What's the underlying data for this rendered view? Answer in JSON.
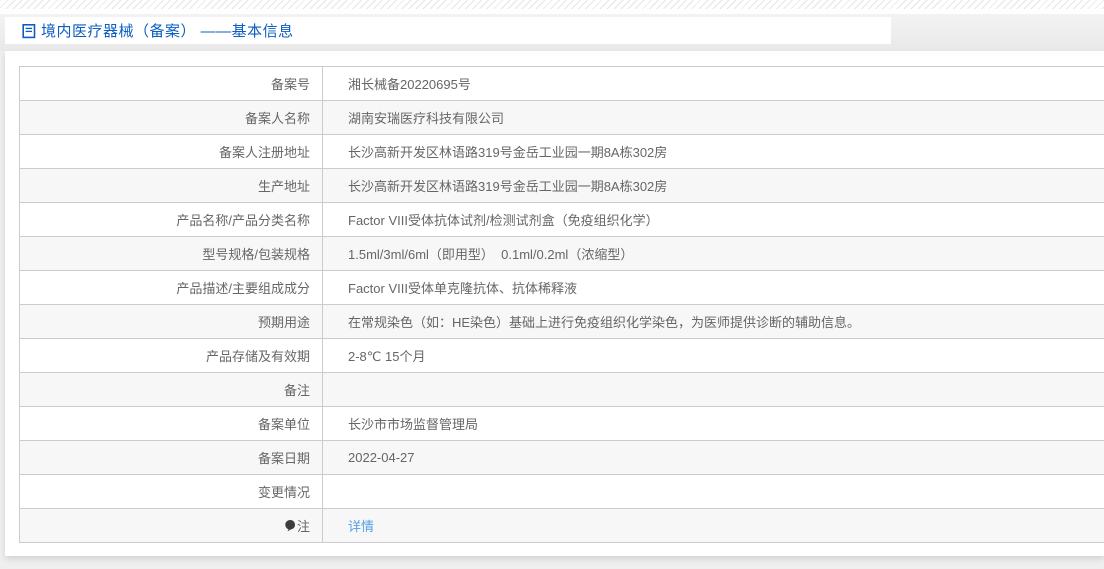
{
  "header": {
    "title": "境内医疗器械（备案） ——基本信息",
    "icon": "document-icon"
  },
  "table": {
    "rows": [
      {
        "label": "备案号",
        "value": "湘长械备20220695号"
      },
      {
        "label": "备案人名称",
        "value": "湖南安瑞医疗科技有限公司"
      },
      {
        "label": "备案人注册地址",
        "value": "长沙高新开发区林语路319号金岳工业园一期8A栋302房"
      },
      {
        "label": "生产地址",
        "value": "长沙高新开发区林语路319号金岳工业园一期8A栋302房"
      },
      {
        "label": "产品名称/产品分类名称",
        "value": "Factor VIII受体抗体试剂/检测试剂盒（免疫组织化学）"
      },
      {
        "label": "型号规格/包装规格",
        "value": "1.5ml/3ml/6ml（即用型）  0.1ml/0.2ml（浓缩型）"
      },
      {
        "label": "产品描述/主要组成成分",
        "value": "Factor VIII受体单克隆抗体、抗体稀释液"
      },
      {
        "label": "预期用途",
        "value": "在常规染色（如：HE染色）基础上进行免疫组织化学染色，为医师提供诊断的辅助信息。"
      },
      {
        "label": "产品存储及有效期",
        "value": "2-8℃ 15个月"
      },
      {
        "label": "备注",
        "value": ""
      },
      {
        "label": "备案单位",
        "value": "长沙市市场监督管理局"
      },
      {
        "label": "备案日期",
        "value": "2022-04-27"
      },
      {
        "label": "变更情况",
        "value": ""
      },
      {
        "label": "注",
        "value": "",
        "icon": "note-icon",
        "link": "详情"
      }
    ]
  },
  "colors": {
    "title_blue": "#0c5ec2",
    "link_blue": "#54a0e8",
    "text_gray": "#666666",
    "row_alt_bg": "#f7f7f7",
    "border_gray": "#cccccc",
    "band_gray": "#ebebeb"
  }
}
